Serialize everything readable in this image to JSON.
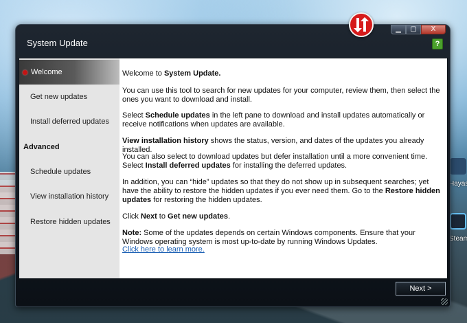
{
  "window": {
    "title": "System Update",
    "controls": {
      "minimize": "▁",
      "maximize": "▢",
      "close": "X"
    },
    "help_icon": "?",
    "next_label": "Next >"
  },
  "desktop": {
    "icon1_label": "Hayas",
    "icon2_label": "Steam"
  },
  "sidebar": {
    "items": [
      {
        "label": "Welcome"
      },
      {
        "label": "Get new updates"
      },
      {
        "label": "Install deferred updates"
      },
      {
        "label": "Advanced"
      },
      {
        "label": "Schedule updates"
      },
      {
        "label": "View installation history"
      },
      {
        "label": "Restore hidden updates"
      }
    ]
  },
  "content": {
    "p1_a": "Welcome to ",
    "p1_b": "System Update.",
    "p2": "You can use this tool to search for new updates for your computer, review them, then select the ones you want to download and install.",
    "p3_a": "Select ",
    "p3_b": "Schedule updates",
    "p3_c": " in the left pane to download and install updates automatically or receive notifications when updates are available.",
    "p4_a": "View installation history",
    "p4_b": " shows the status, version, and dates of the updates you already installed.",
    "p5_a": "You can also select to download updates but defer installation until a more convenient time. Select ",
    "p5_b": "Install deferred updates",
    "p5_c": " for installing the deferred updates.",
    "p6_a": "In addition, you can “hide” updates so that they do not show up in subsequent searches; yet have the ability to restore the hidden updates if you ever need them. Go to the ",
    "p6_b": "Restore hidden updates",
    "p6_c": " for restoring the hidden updates.",
    "p7_a": "Click ",
    "p7_b": "Next",
    "p7_c": " to ",
    "p7_d": "Get new updates",
    "p7_e": ".",
    "p8_a": "Note:",
    "p8_b": " Some of the updates depends on certain Windows components. Ensure that your Windows operating system is most up-to-date by running Windows Updates.",
    "link": "Click here to learn more."
  }
}
